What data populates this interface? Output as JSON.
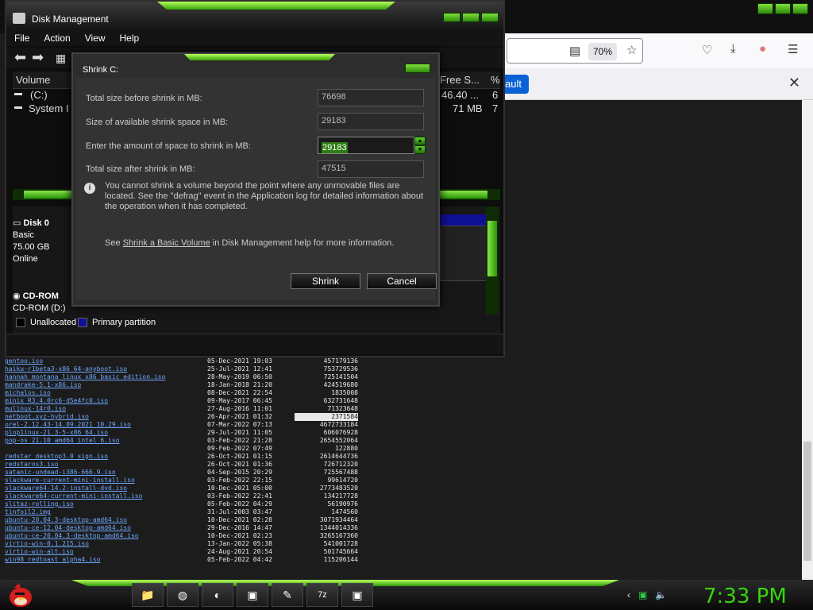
{
  "browser": {
    "zoom": "70%",
    "notif_button": "ault"
  },
  "listing": [
    {
      "name": "gentoo.iso",
      "date": "05-Dec-2021 19:03",
      "size": "457179136"
    },
    {
      "name": "haiku-r1beta3-x86_64-anyboot.iso",
      "date": "25-Jul-2021 12:41",
      "size": "753729536"
    },
    {
      "name": "hannah_montana_linux_x86_basic_edition.iso",
      "date": "28-May-2019 06:50",
      "size": "725141504"
    },
    {
      "name": "mandrake-5.1-x86.iso",
      "date": "18-Jan-2018 21:20",
      "size": "424519680"
    },
    {
      "name": "michalos.iso",
      "date": "08-Dec-2021 22:54",
      "size": "1835008"
    },
    {
      "name": "minix_R3.4.0rc6-d5e4fc0.iso",
      "date": "09-May-2017 06:45",
      "size": "632731648"
    },
    {
      "name": "mulinux-14r0.iso",
      "date": "27-Aug-2016 11:01",
      "size": "71323648"
    },
    {
      "name": "netboot.xyz-hybrid.iso",
      "date": "26-Apr-2021 01:32",
      "size": "2371584",
      "selected": true
    },
    {
      "name": "orel-2.12.43-14.09.2021_10.29.iso",
      "date": "07-Mar-2022 07:13",
      "size": "4672733184"
    },
    {
      "name": "plop1inux-21.3-5-x86_64.iso",
      "date": "29-Jul-2021 11:05",
      "size": "606076928"
    },
    {
      "name": "pop-os_21.10_amd64_intel_6.iso",
      "date": "03-Feb-2022 21:28",
      "size": "2654552064"
    },
    {
      "name": "",
      "date": "09-Feb-2022 07:49",
      "size": "122880",
      "visited": true
    },
    {
      "name": "redstar_desktop3.0_sign.iso",
      "date": "26-Oct-2021 01:15",
      "size": "2614644736"
    },
    {
      "name": "redstaros3.iso",
      "date": "26-Oct-2021 01:36",
      "size": "726712320"
    },
    {
      "name": "satanic-undead-i386-666.9.iso",
      "date": "04-Sep-2015 20:29",
      "size": "725567488"
    },
    {
      "name": "slackware-current-mini-install.iso",
      "date": "03-Feb-2022 22:15",
      "size": "99614720"
    },
    {
      "name": "slackware64-14.2-install-dvd.iso",
      "date": "10-Dec-2021 05:00",
      "size": "2773483520"
    },
    {
      "name": "slackware64-current-mini-install.iso",
      "date": "03-Feb-2022 22:41",
      "size": "134217728"
    },
    {
      "name": "slitaz-rolling.iso",
      "date": "05-Feb-2022 04:29",
      "size": "56190976"
    },
    {
      "name": "tinfoil2.img",
      "date": "31-Jul-2003 03:47",
      "size": "1474560"
    },
    {
      "name": "ubuntu-20.04.3-desktop-amd64.iso",
      "date": "10-Dec-2021 02:28",
      "size": "3071934464"
    },
    {
      "name": "ubuntu-ce-12.04-desktop-amd64.iso",
      "date": "29-Dec-2016 14:47",
      "size": "1344014336"
    },
    {
      "name": "ubuntu-ce-20.04.3-desktop-amd64.iso",
      "date": "10-Dec-2021 02:23",
      "size": "3265167360"
    },
    {
      "name": "virtio-win-0.1.215.iso",
      "date": "13-Jan-2022 05:38",
      "size": "541001728"
    },
    {
      "name": "virtio-win-alt.iso",
      "date": "24-Aug-2021 20:54",
      "size": "501745664"
    },
    {
      "name": "win98_redtoast_alpha4.iso",
      "date": "05-Feb-2022 04:42",
      "size": "115206144"
    }
  ],
  "diskmgmt": {
    "title": "Disk Management",
    "menu": [
      "File",
      "Action",
      "View",
      "Help"
    ],
    "columns": {
      "volume": "Volume",
      "free": "Free S...",
      "pct": "%"
    },
    "volumes": [
      {
        "name": "(C:)",
        "free": "46.40 ...",
        "pct": "6"
      },
      {
        "name": "System I",
        "free": "71 MB",
        "pct": "7"
      }
    ],
    "disk0": {
      "name": "Disk 0",
      "type": "Basic",
      "size": "75.00 GB",
      "status": "Online"
    },
    "cdrom": {
      "name": "CD-ROM",
      "drive": "CD-ROM (D:)"
    },
    "legend": {
      "unallocated": "Unallocated",
      "primary": "Primary partition"
    }
  },
  "shrink": {
    "title": "Shrink C:",
    "label_total_before": "Total size before shrink in MB:",
    "total_before": "76698",
    "label_available": "Size of available shrink space in MB:",
    "available": "29183",
    "label_amount": "Enter the amount of space to shrink in MB:",
    "amount": "29183",
    "label_total_after": "Total size after shrink in MB:",
    "total_after": "47515",
    "info": "You cannot shrink a volume beyond the point where any unmovable files are located. See the \"defrag\" event in the Application log for detailed information about the operation when it has completed.",
    "see_prefix": "See ",
    "see_link": "Shrink a Basic Volume",
    "see_suffix": " in Disk Management help for more information.",
    "shrink_button": "Shrink",
    "cancel_button": "Cancel"
  },
  "taskbar": {
    "clock": "7:33 PM"
  },
  "colors": {
    "accent": "#36d60c",
    "link": "#6ea8ff"
  }
}
